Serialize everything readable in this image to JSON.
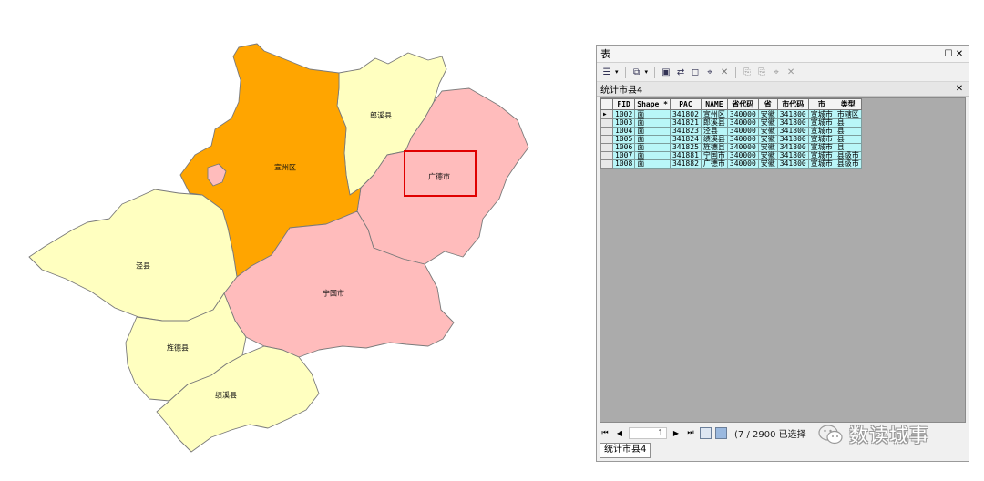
{
  "map": {
    "regions": [
      {
        "name": "宣州区",
        "color": "#ffa500"
      },
      {
        "name": "郎溪县",
        "color": "#ffffc0"
      },
      {
        "name": "广德市",
        "color": "#ffbcbc"
      },
      {
        "name": "泾县",
        "color": "#ffffc0"
      },
      {
        "name": "宁国市",
        "color": "#ffbcbc"
      },
      {
        "name": "旌德县",
        "color": "#ffffc0"
      },
      {
        "name": "绩溪县",
        "color": "#ffffc0"
      }
    ],
    "highlight_color": "#e00000"
  },
  "window": {
    "title": "表",
    "tab_title": "统计市县4",
    "columns": [
      "FID",
      "Shape *",
      "PAC",
      "NAME",
      "省代码",
      "省",
      "市代码",
      "市",
      "类型"
    ],
    "rows": [
      [
        "1002",
        "面",
        "341802",
        "宣州区",
        "340000",
        "安徽",
        "341800",
        "宣城市",
        "市辖区"
      ],
      [
        "1003",
        "面",
        "341821",
        "郎溪县",
        "340000",
        "安徽",
        "341800",
        "宣城市",
        "县"
      ],
      [
        "1004",
        "面",
        "341823",
        "泾县",
        "340000",
        "安徽",
        "341800",
        "宣城市",
        "县"
      ],
      [
        "1005",
        "面",
        "341824",
        "绩溪县",
        "340000",
        "安徽",
        "341800",
        "宣城市",
        "县"
      ],
      [
        "1006",
        "面",
        "341825",
        "旌德县",
        "340000",
        "安徽",
        "341800",
        "宣城市",
        "县"
      ],
      [
        "1007",
        "面",
        "341881",
        "宁国市",
        "340000",
        "安徽",
        "341800",
        "宣城市",
        "县级市"
      ],
      [
        "1008",
        "面",
        "341882",
        "广德市",
        "340000",
        "安徽",
        "341800",
        "宣城市",
        "县级市"
      ]
    ],
    "nav": {
      "record": "1",
      "status": "(7 / 2900 已选择"
    },
    "bottom_tab": "统计市县4"
  },
  "watermark": "数读城事"
}
